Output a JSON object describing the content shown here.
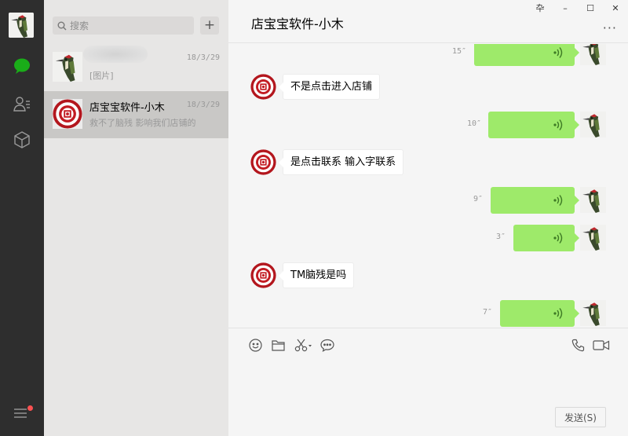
{
  "window": {
    "pin_label": "卆",
    "minimize_label": "–",
    "maximize_label": "☐",
    "close_label": "✕"
  },
  "sidebar": {
    "items": [
      {
        "icon": "chat-bubble-icon",
        "active": true
      },
      {
        "icon": "contacts-icon",
        "active": false
      },
      {
        "icon": "box-icon",
        "active": false
      }
    ],
    "menu_has_badge": true,
    "accent": "#1aad19"
  },
  "search": {
    "placeholder": "搜索",
    "add_label": "+"
  },
  "sessions": [
    {
      "name": "",
      "time": "18/3/29",
      "preview": "[图片]"
    },
    {
      "name": "店宝宝软件-小木",
      "time": "18/3/29",
      "preview": "救不了脑残 影响我们店铺的"
    }
  ],
  "chat": {
    "title": "店宝宝软件-小木",
    "more_label": "···",
    "messages": [
      {
        "type": "voice_out",
        "duration": "15″"
      },
      {
        "type": "text_in",
        "text": "不是点击进入店铺"
      },
      {
        "type": "voice_out",
        "duration": "10″"
      },
      {
        "type": "text_in",
        "text": "是点击联系 输入字联系"
      },
      {
        "type": "voice_out",
        "duration": "9″"
      },
      {
        "type": "voice_out",
        "duration": "3″"
      },
      {
        "type": "text_in",
        "text": "TM脑残是吗"
      },
      {
        "type": "voice_out",
        "duration": "7″"
      }
    ],
    "toolbar_icons": [
      "emoji-icon",
      "folder-icon",
      "scissors-icon",
      "comment-icon",
      "phone-icon",
      "video-icon"
    ],
    "send_label": "发送(S)"
  },
  "colors": {
    "voice_bubble": "#9eea6a",
    "rail": "#2e2e2e",
    "list_bg": "#e7e6e5",
    "chat_bg": "#f5f5f5"
  }
}
